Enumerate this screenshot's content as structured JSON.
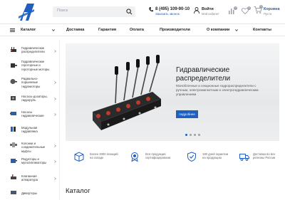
{
  "header": {
    "search_placeholder": "Поиск",
    "phone": "8 (495) 109-90-10",
    "callback": "Заказать звонок",
    "login": "Войти",
    "login_sub": "Мой кабинет",
    "cart_label": "Корзина",
    "cart_sub": "Пуста",
    "compare_count": "0",
    "favorites_count": "0",
    "cart_count": "0"
  },
  "nav": {
    "catalog": "Каталог",
    "items": [
      "Доставка",
      "Гарантия",
      "Оплата",
      "Производители",
      "О компании",
      "Контакты"
    ]
  },
  "sidebar": {
    "items": [
      {
        "label": "Гидравлические распределители",
        "icon": "valve-thumb-icon"
      },
      {
        "label": "Гидравлические героторные и героторные моторы",
        "icon": "motor-thumb-icon"
      },
      {
        "label": "Радиально-поршневые гидромоторы",
        "icon": "radial-motor-thumb-icon"
      },
      {
        "label": "Насосы-дозаторы, гидроруль",
        "icon": "pump-thumb-icon"
      },
      {
        "label": "Насосы гидравлические",
        "icon": "hydraulic-pump-thumb-icon"
      },
      {
        "label": "Модульная гидравлика",
        "icon": "module-thumb-icon"
      },
      {
        "label": "Колонки и соединительные муфты",
        "icon": "coupling-thumb-icon"
      },
      {
        "label": "Редукторы и мультипликаторы",
        "icon": "reducer-thumb-icon"
      },
      {
        "label": "Клапанная аппаратура",
        "icon": "valves-thumb-icon"
      },
      {
        "label": "Диверторы",
        "icon": "divertor-thumb-icon"
      }
    ]
  },
  "banner": {
    "title": "Гидравлические распределители",
    "text": "Моноблочные и секционные гидрораспределители с ручным, электромагнитным и электрогидравлическим управлением",
    "button": "подробнее"
  },
  "features": [
    {
      "text": "Более 3000 позиций на складе",
      "icon": "box-icon"
    },
    {
      "text": "Вся продукция сертифицирована",
      "icon": "certificate-icon"
    },
    {
      "text": "180 дней гарантии на продукцию",
      "icon": "shield-icon"
    },
    {
      "text": "Доставка во все регионы России",
      "icon": "truck-icon"
    }
  ],
  "catalog_title": "Каталог",
  "colors": {
    "accent": "#1f5fbf",
    "logo": "#1f5fbf"
  }
}
